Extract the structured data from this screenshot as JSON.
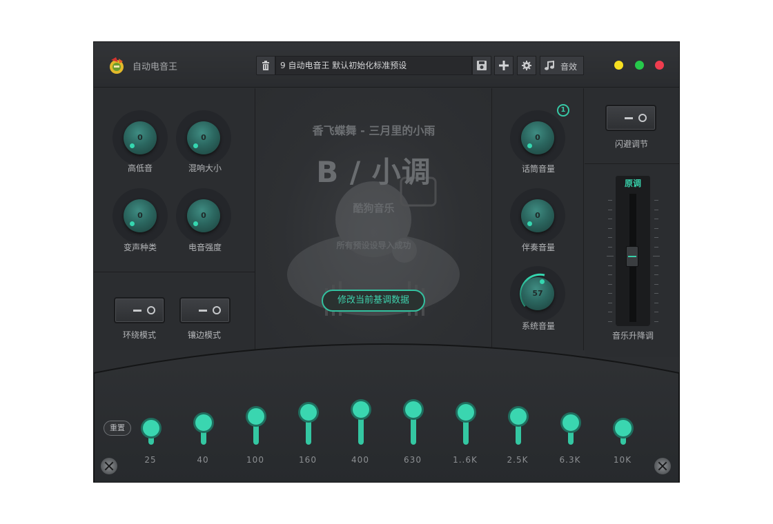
{
  "app": {
    "title": "自动电音王"
  },
  "toolbar": {
    "preset_value": "9  自动电音王 默认初始化标准预设",
    "effects_label": "音效"
  },
  "left_panel": {
    "knobs": [
      {
        "label": "高低音",
        "value": "0"
      },
      {
        "label": "混响大小",
        "value": "0"
      },
      {
        "label": "变声种类",
        "value": "0"
      },
      {
        "label": "电音强度",
        "value": "0"
      }
    ],
    "toggles": [
      {
        "label": "环绕模式"
      },
      {
        "label": "镶边模式"
      }
    ]
  },
  "center": {
    "song_title": "香飞蝶舞 - 三月里的小雨",
    "song_key": "B / 小调",
    "source": "酷狗音乐",
    "status": "所有预设设导入成功",
    "modify_button": "修改当前基调数据"
  },
  "right_panel": {
    "badge": "1",
    "knobs": [
      {
        "label": "话筒音量",
        "value": "0"
      },
      {
        "label": "伴奏音量",
        "value": "0"
      },
      {
        "label": "系统音量",
        "value": "57"
      }
    ]
  },
  "far_right": {
    "dodge_label": "闪避调节",
    "pitch_header": "原调",
    "pitch_label": "音乐升降调"
  },
  "eq": {
    "reset_label": "重置",
    "bands": [
      {
        "label": "25",
        "level": 0.34
      },
      {
        "label": "40",
        "level": 0.4
      },
      {
        "label": "100",
        "level": 0.48
      },
      {
        "label": "160",
        "level": 0.52
      },
      {
        "label": "400",
        "level": 0.55
      },
      {
        "label": "630",
        "level": 0.55
      },
      {
        "label": "1..6K",
        "level": 0.52
      },
      {
        "label": "2.5K",
        "level": 0.48
      },
      {
        "label": "6.3K",
        "level": 0.4
      },
      {
        "label": "10K",
        "level": 0.34
      }
    ]
  },
  "colors": {
    "accent": "#38cfa9",
    "bg": "#2c2e31",
    "win_min": "#f7e021",
    "win_max": "#26c94b",
    "win_close": "#ef3d4f"
  },
  "icons": [
    "app-logo",
    "trash-icon",
    "save-icon",
    "plus-icon",
    "gear-icon",
    "music-note-icon",
    "screw-icon"
  ]
}
